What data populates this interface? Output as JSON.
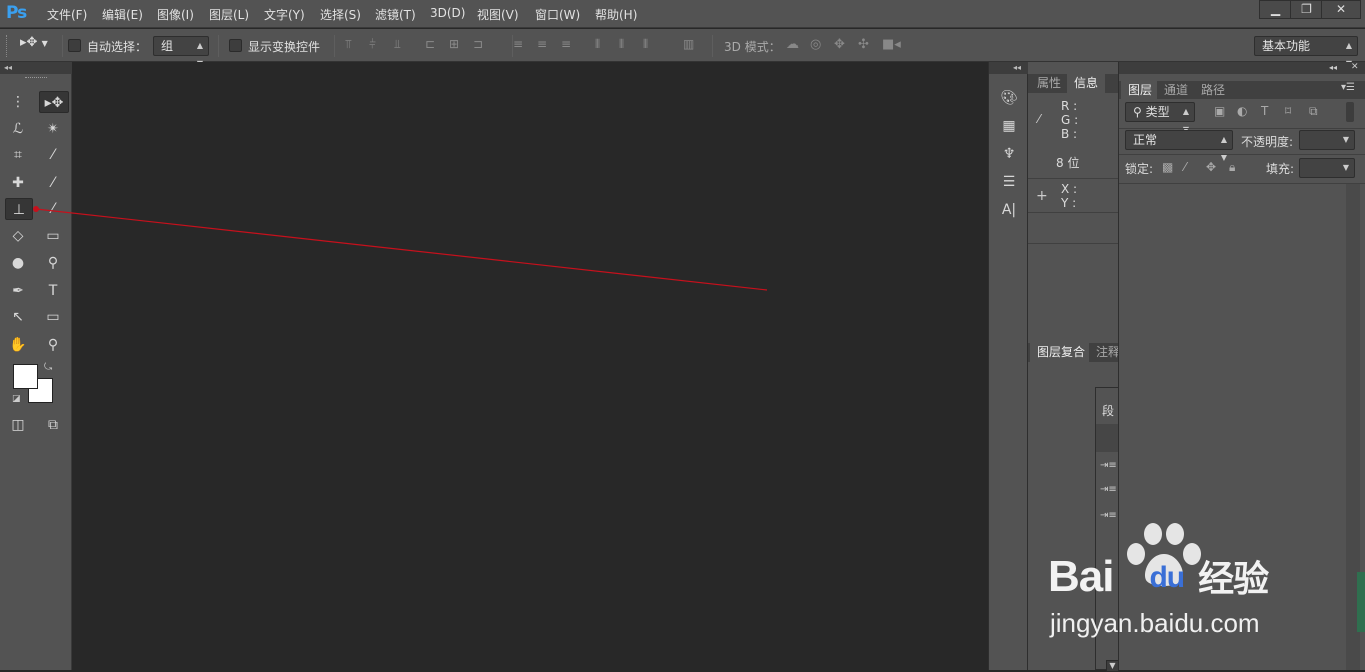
{
  "app": {
    "logo": "Ps"
  },
  "menu": [
    "文件(F)",
    "编辑(E)",
    "图像(I)",
    "图层(L)",
    "文字(Y)",
    "选择(S)",
    "滤镜(T)",
    "3D(D)",
    "视图(V)",
    "窗口(W)",
    "帮助(H)"
  ],
  "window_controls": {
    "minimize": "▁",
    "restore": "❐",
    "close": "✕"
  },
  "options": {
    "auto_select_label": "自动选择：",
    "auto_select_value": "组",
    "show_transform_label": "显示变换控件",
    "mode_3d_label": "3D 模式：",
    "workspace": "基本功能"
  },
  "info_panel": {
    "tabs": [
      "属性",
      "信息"
    ],
    "r": "R :",
    "g": "G :",
    "b": "B :",
    "bits": "8 位",
    "x": "X :",
    "y": "Y :",
    "bottom_tabs": [
      "图层复合",
      "注释"
    ],
    "para_tab": "段"
  },
  "layers_panel": {
    "tabs": [
      "图层",
      "通道",
      "路径"
    ],
    "filter_type": "类型",
    "blend_mode": "正常",
    "opacity_label": "不透明度:",
    "lock_label": "锁定:",
    "fill_label": "填充:"
  },
  "watermark": {
    "brand": "Bai",
    "brand2": "du",
    "jingyan": "经验",
    "url": "jingyan.baidu.com"
  },
  "colors": {
    "annotation_arrow": "#c8101c",
    "ps_blue": "#3aa0f0"
  }
}
